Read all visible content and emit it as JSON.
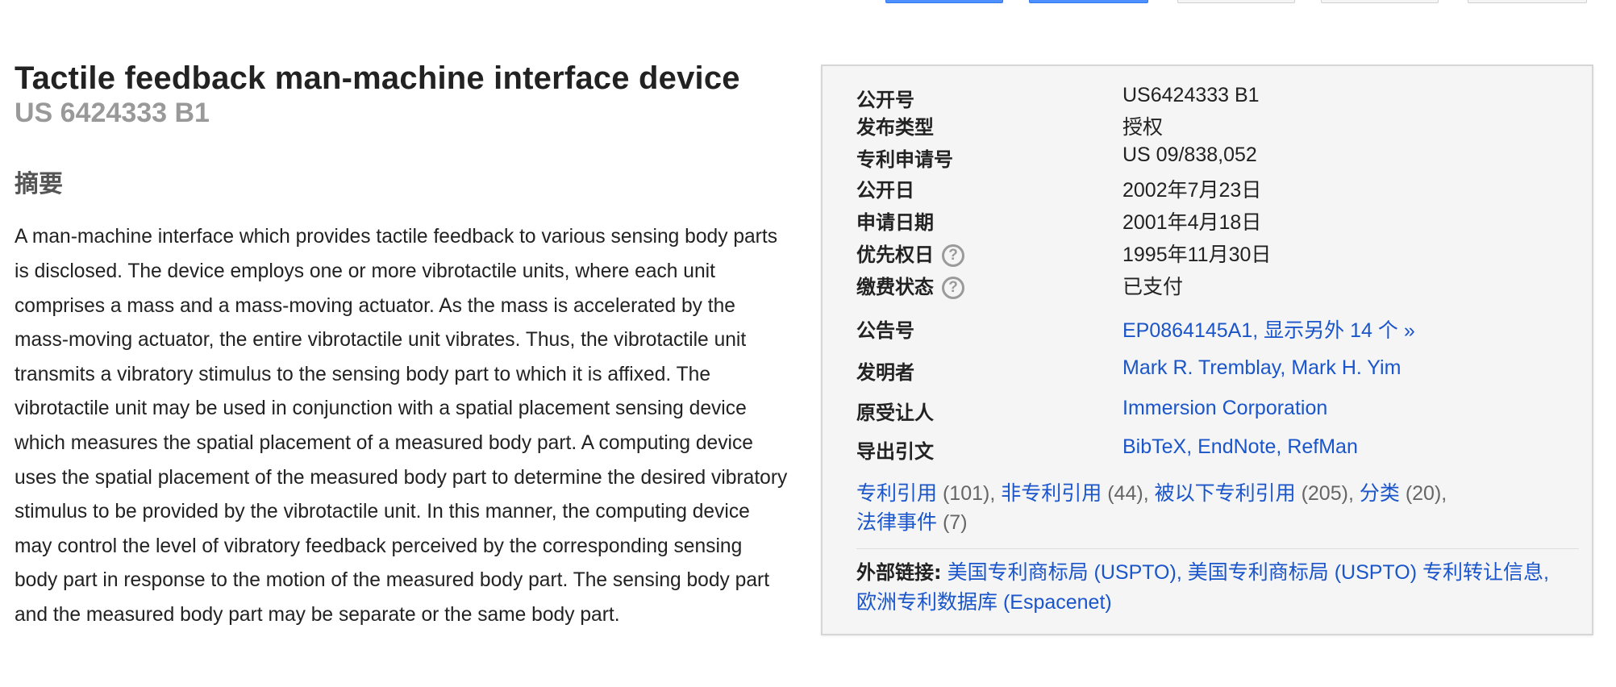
{
  "patent": {
    "title": "Tactile feedback man-machine interface device",
    "number": "US 6424333 B1"
  },
  "abstract": {
    "heading": "摘要",
    "text": "A man-machine interface which provides tactile feedback to various sensing body parts is disclosed. The device employs one or more vibrotactile units, where each unit comprises a mass and a mass-moving actuator. As the mass is accelerated by the mass-moving actuator, the entire vibrotactile unit vibrates. Thus, the vibrotactile unit transmits a vibratory stimulus to the sensing body part to which it is affixed. The vibrotactile unit may be used in conjunction with a spatial placement sensing device which measures the spatial placement of a measured body part. A computing device uses the spatial placement of the measured body part to determine the desired vibratory stimulus to be provided by the vibrotactile unit. In this manner, the computing device may control the level of vibratory feedback perceived by the corresponding sensing body part in response to the motion of the measured body part. The sensing body part and the measured body part may be separate or the same body part."
  },
  "info": {
    "publication_number": {
      "label": "公开号",
      "value": "US6424333 B1"
    },
    "publication_type": {
      "label": "发布类型",
      "value": "授权"
    },
    "application_number": {
      "label": "专利申请号",
      "value": "US 09/838,052"
    },
    "publication_date": {
      "label": "公开日",
      "value": "2002年7月23日"
    },
    "filing_date": {
      "label": "申请日期",
      "value": "2001年4月18日"
    },
    "priority_date": {
      "label": "优先权日",
      "value": "1995年11月30日",
      "help": "?"
    },
    "fee_status": {
      "label": "缴费状态",
      "value": "已支付",
      "help": "?"
    },
    "also_published": {
      "label": "公告号",
      "link": "EP0864145A1",
      "sep": ", ",
      "more": "显示另外 14 个 »"
    },
    "inventors": {
      "label": "发明者",
      "names": [
        "Mark R. Tremblay",
        "Mark H. Yim"
      ],
      "sep": ", "
    },
    "assignee": {
      "label": "原受让人",
      "value": "Immersion Corporation"
    },
    "export": {
      "label": "导出引文",
      "formats": [
        "BibTeX",
        "EndNote",
        "RefMan"
      ],
      "sep": ", "
    }
  },
  "citations": [
    {
      "label": "专利引用",
      "count": "(101)",
      "sep": ", "
    },
    {
      "label": "非专利引用",
      "count": "(44)",
      "sep": ", "
    },
    {
      "label": "被以下专利引用",
      "count": "(205)",
      "sep": ", "
    },
    {
      "label": "分类",
      "count": "(20)",
      "sep": ","
    },
    {
      "label": "法律事件",
      "count": "(7)",
      "sep": ""
    }
  ],
  "external_links": {
    "label": "外部链接:",
    "links": [
      {
        "text": "美国专利商标局 (USPTO)",
        "sep": ", "
      },
      {
        "text": "美国专利商标局 (USPTO) 专利转让信息",
        "sep": ", "
      },
      {
        "text": "欧洲专利数据库 (Espacenet)",
        "sep": ""
      }
    ]
  },
  "colors": {
    "link": "#1a55c9",
    "muted": "#999999",
    "primary_button": "#4d90fe"
  }
}
